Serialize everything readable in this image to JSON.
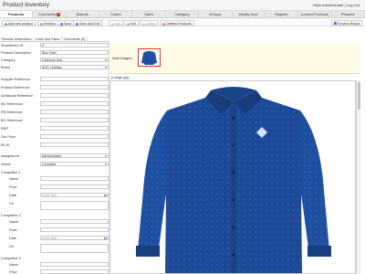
{
  "window": {
    "title": "Product Inventory",
    "greeting": "Hello Administrator | Log Out"
  },
  "nav": [
    {
      "label": "Products",
      "active": true
    },
    {
      "label": "Comments",
      "badge": "1"
    },
    {
      "label": "Brands"
    },
    {
      "label": "Colors"
    },
    {
      "label": "Sizes"
    },
    {
      "label": "Category"
    },
    {
      "label": "Groups"
    },
    {
      "label": "Modify User"
    },
    {
      "label": "Register"
    },
    {
      "label": "Locked Products"
    },
    {
      "label": "Phrases"
    }
  ],
  "toolbar": {
    "add_new": "Add new product",
    "refresh": "Refresh",
    "save": "Save",
    "save_exit": "Save And Exit",
    "edit": "Edit",
    "exit": "Exit",
    "delete": "Delete",
    "deleted_products": "Deleted Products",
    "preview": "Preview Result"
  },
  "subtabs": [
    {
      "label": "Product Information",
      "active": true
    },
    {
      "label": "Color and Sizes"
    },
    {
      "label": "Comments (0)"
    }
  ],
  "form": {
    "showitem_id": {
      "label": "ShowItem's ID",
      "value": "0"
    },
    "product_description": {
      "label": "Product Description",
      "value": "Blue Shirt"
    },
    "category": {
      "label": "Category",
      "value": "Category One"
    },
    "brand": {
      "label": "Brand",
      "value": "AOD | Adidas"
    },
    "supplier_reference": {
      "label": "Supplier Reference",
      "value": ""
    },
    "product_reference": {
      "label": "Product Reference",
      "value": ""
    },
    "additional_reference": {
      "label": "Additional Reference",
      "value": ""
    },
    "bd_reference": {
      "label": "BD Reference",
      "value": ""
    },
    "pb_reference": {
      "label": "PB Reference",
      "value": ""
    },
    "bc_reference": {
      "label": "BC Reference",
      "value": ""
    },
    "rrp": {
      "label": "RRP",
      "value": ""
    },
    "our_price": {
      "label": "Our Price",
      "value": ""
    },
    "ebid": {
      "label": "Eb ID",
      "value": ""
    },
    "assigned_to": {
      "label": "Assigned to",
      "value": "Administrator"
    },
    "status": {
      "label": "Status",
      "value": "Complete"
    },
    "competitors": [
      {
        "label": "Competitor 1",
        "fields": {
          "name": "Name",
          "price": "Price",
          "date": "Date",
          "date_placeholder": "Enter date",
          "url": "Url"
        }
      },
      {
        "label": "Competitor 2",
        "fields": {
          "name": "Name",
          "price": "Price",
          "date": "Date",
          "date_placeholder": "Enter date",
          "url": "Url"
        }
      },
      {
        "label": "Competitor 3",
        "fields": {
          "name": "Name",
          "price": "Price"
        }
      }
    ]
  },
  "images": {
    "add_label": "Add Images:",
    "filename": "p-large.jpg"
  },
  "colors": {
    "accent": "#c0392b",
    "shirt": "#1f4fa0",
    "tab_bg": "#e8e8e8"
  }
}
